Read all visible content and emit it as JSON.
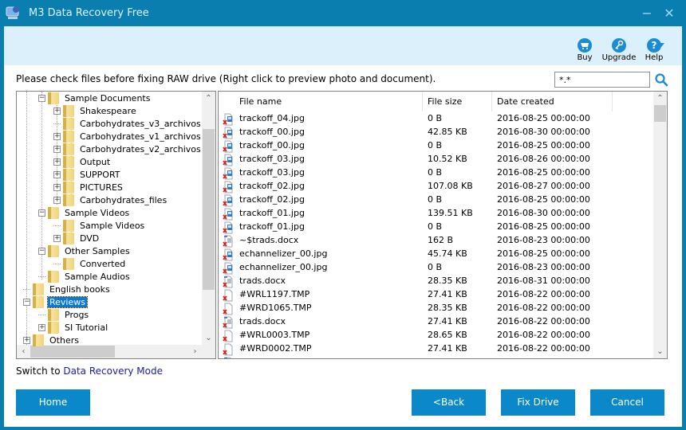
{
  "window": {
    "title": "M3 Data Recovery Free",
    "minimize_glyph": "−",
    "close_glyph": "✕"
  },
  "toolbar": {
    "buy_label": "Buy",
    "upgrade_label": "Upgrade",
    "help_label": "Help",
    "help_glyph": "?"
  },
  "instruction": "Please check files before fixing RAW drive (Right click to preview photo and document).",
  "search": {
    "value": "*.*"
  },
  "tree": {
    "items": [
      {
        "label": "Sample Documents",
        "level": 2,
        "expander": "minus"
      },
      {
        "label": "Shakespeare",
        "level": 3,
        "expander": "plus"
      },
      {
        "label": "Carbohydrates_v3_archivos",
        "level": 3,
        "expander": "none"
      },
      {
        "label": "Carbohydrates_v1_archivos",
        "level": 3,
        "expander": "plus"
      },
      {
        "label": "Carbohydrates_v2_archivos",
        "level": 3,
        "expander": "plus"
      },
      {
        "label": "Output",
        "level": 3,
        "expander": "plus"
      },
      {
        "label": "SUPPORT",
        "level": 3,
        "expander": "plus"
      },
      {
        "label": "PICTURES",
        "level": 3,
        "expander": "plus"
      },
      {
        "label": "Carbohydrates_files",
        "level": 3,
        "expander": "plus"
      },
      {
        "label": "Sample Videos",
        "level": 2,
        "expander": "minus"
      },
      {
        "label": "Sample Videos",
        "level": 3,
        "expander": "none"
      },
      {
        "label": "DVD",
        "level": 3,
        "expander": "plus"
      },
      {
        "label": "Other Samples",
        "level": 2,
        "expander": "minus"
      },
      {
        "label": "Converted",
        "level": 3,
        "expander": "none"
      },
      {
        "label": "Sample Audios",
        "level": 2,
        "expander": "none"
      },
      {
        "label": "English books",
        "level": 1,
        "expander": "none"
      },
      {
        "label": "Reviews",
        "level": 1,
        "expander": "minus",
        "selected": true
      },
      {
        "label": "Progs",
        "level": 2,
        "expander": "none"
      },
      {
        "label": "SI Tutorial",
        "level": 2,
        "expander": "plus"
      },
      {
        "label": "Others",
        "level": 1,
        "expander": "plus"
      }
    ]
  },
  "file_list": {
    "columns": [
      "File name",
      "File size",
      "Date created"
    ],
    "rows": [
      {
        "name": "trackoff_04.jpg",
        "size": "0 B",
        "date": "2016-08-25 00:00:00",
        "type": "image"
      },
      {
        "name": "trackoff_00.jpg",
        "size": "42.85 KB",
        "date": "2016-08-30 00:00:00",
        "type": "image"
      },
      {
        "name": "trackoff_00.jpg",
        "size": "0 B",
        "date": "2016-08-25 00:00:00",
        "type": "image"
      },
      {
        "name": "trackoff_03.jpg",
        "size": "10.52 KB",
        "date": "2016-08-26 00:00:00",
        "type": "image"
      },
      {
        "name": "trackoff_03.jpg",
        "size": "0 B",
        "date": "2016-08-25 00:00:00",
        "type": "image"
      },
      {
        "name": "trackoff_02.jpg",
        "size": "107.08 KB",
        "date": "2016-08-27 00:00:00",
        "type": "image"
      },
      {
        "name": "trackoff_02.jpg",
        "size": "0 B",
        "date": "2016-08-25 00:00:00",
        "type": "image"
      },
      {
        "name": "trackoff_01.jpg",
        "size": "139.51 KB",
        "date": "2016-08-30 00:00:00",
        "type": "image"
      },
      {
        "name": "trackoff_01.jpg",
        "size": "0 B",
        "date": "2016-08-25 00:00:00",
        "type": "image"
      },
      {
        "name": "~$trads.docx",
        "size": "162 B",
        "date": "2016-08-23 00:00:00",
        "type": "doc"
      },
      {
        "name": "echannelizer_00.jpg",
        "size": "45.74 KB",
        "date": "2016-08-25 00:00:00",
        "type": "image"
      },
      {
        "name": "echannelizer_00.jpg",
        "size": "0 B",
        "date": "2016-08-23 00:00:00",
        "type": "image"
      },
      {
        "name": "trads.docx",
        "size": "28.35 KB",
        "date": "2016-08-31 00:00:00",
        "type": "doc"
      },
      {
        "name": "#WRL1197.TMP",
        "size": "27.41 KB",
        "date": "2016-08-22 00:00:00",
        "type": "file"
      },
      {
        "name": "#WRD1065.TMP",
        "size": "28.35 KB",
        "date": "2016-08-22 00:00:00",
        "type": "file"
      },
      {
        "name": "trads.docx",
        "size": "27.41 KB",
        "date": "2016-08-22 00:00:00",
        "type": "doc"
      },
      {
        "name": "#WRL0003.TMP",
        "size": "28.65 KB",
        "date": "2016-08-22 00:00:00",
        "type": "file"
      },
      {
        "name": "#WRD0002.TMP",
        "size": "27.41 KB",
        "date": "2016-08-22 00:00:00",
        "type": "file"
      }
    ]
  },
  "footer": {
    "switch_prefix": "Switch to",
    "switch_link": "Data Recovery Mode",
    "home_label": "Home",
    "back_label": "<Back",
    "fix_label": "Fix Drive",
    "cancel_label": "Cancel"
  },
  "colors": {
    "titlebar": "#0a7eae",
    "toolbar_bg": "#dcf0fc",
    "button_bg": "#0a88ca",
    "selection": "#0a78d7",
    "link": "#1a1aa6",
    "delete_mark": "#d42020"
  }
}
